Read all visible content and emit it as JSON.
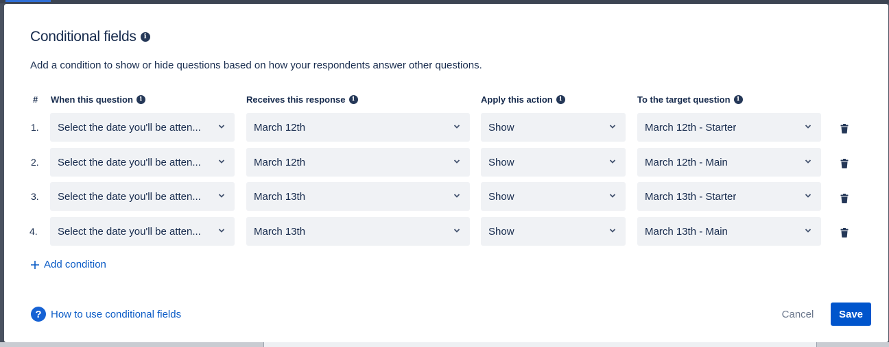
{
  "dialog": {
    "title": "Conditional fields",
    "description": "Add a condition to show or hide questions based on how your respondents answer other questions."
  },
  "columns": {
    "number": "#",
    "question": "When this question",
    "response": "Receives this response",
    "action": "Apply this action",
    "target": "To the target question"
  },
  "rows": [
    {
      "num": "1.",
      "question": "Select the date you'll be atten...",
      "response": "March 12th",
      "action": "Show",
      "target": "March 12th - Starter"
    },
    {
      "num": "2.",
      "question": "Select the date you'll be atten...",
      "response": "March 12th",
      "action": "Show",
      "target": "March 12th - Main"
    },
    {
      "num": "3.",
      "question": "Select the date you'll be atten...",
      "response": "March 13th",
      "action": "Show",
      "target": "March 13th - Starter"
    },
    {
      "num": "4.",
      "question": "Select the date you'll be atten...",
      "response": "March 13th",
      "action": "Show",
      "target": "March 13th - Main"
    }
  ],
  "add_condition": {
    "icon": "plus-icon",
    "label": "Add condition"
  },
  "help_link": {
    "icon": "question-circle-icon",
    "label": "How to use conditional fields"
  },
  "footer": {
    "cancel_label": "Cancel",
    "save_label": "Save"
  },
  "colors": {
    "primary": "#0055cc",
    "link": "#0a5bc6",
    "text": "#172b4d",
    "select_bg": "#f0f2f5",
    "muted": "#6b778c"
  }
}
